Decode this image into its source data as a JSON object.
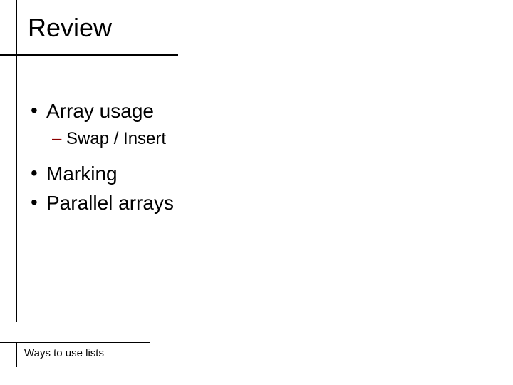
{
  "title": "Review",
  "bullets": {
    "b1_1": "Array usage",
    "b2_1": "Swap / Insert",
    "b1_2": "Marking",
    "b1_3": "Parallel arrays"
  },
  "footer": "Ways to use lists"
}
